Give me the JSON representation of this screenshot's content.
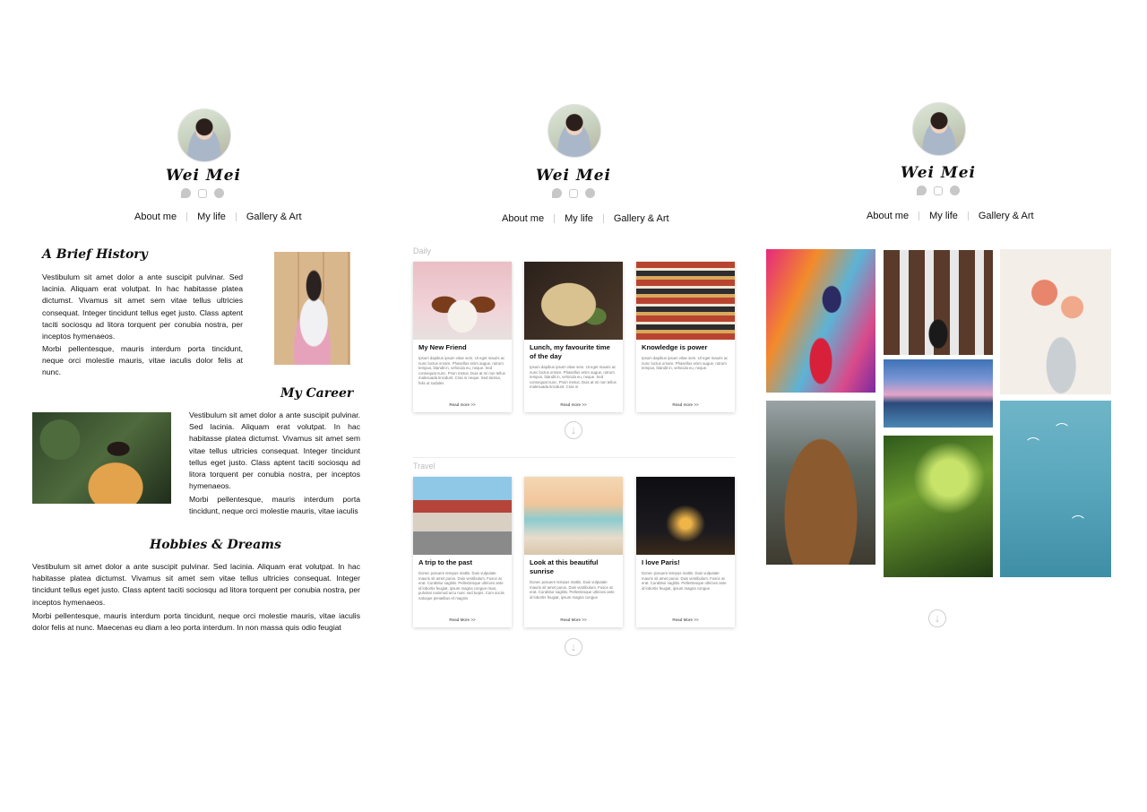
{
  "brand": "Wei Mei",
  "nav": [
    "About me",
    "My life",
    "Gallery & Art"
  ],
  "about": {
    "sections": [
      {
        "heading": "A Brief History",
        "paragraphs": [
          "Vestibulum sit amet dolor a ante suscipit pulvinar. Sed lacinia. Aliquam erat volutpat. In hac habitasse platea dictumst. Vivamus sit amet sem vitae tellus ultricies consequat. Integer tincidunt tellus eget justo. Class aptent taciti sociosqu ad litora torquent per conubia nostra, per inceptos hymenaeos.",
          "Morbi pellentesque, mauris interdum porta tincidunt, neque orci molestie mauris, vitae iaculis dolor felis at nunc."
        ]
      },
      {
        "heading": "My Career",
        "paragraphs": [
          "Vestibulum sit amet dolor a ante suscipit pulvinar. Sed lacinia. Aliquam erat volutpat. In hac habitasse platea dictumst. Vivamus sit amet sem vitae tellus ultricies consequat. Integer tincidunt tellus eget justo. Class aptent taciti sociosqu ad litora torquent per conubia nostra, per inceptos hymenaeos.",
          "Morbi pellentesque, mauris interdum porta tincidunt, neque orci molestie mauris, vitae iaculis"
        ]
      },
      {
        "heading": "Hobbies & Dreams",
        "paragraphs": [
          "Vestibulum sit amet dolor a ante suscipit pulvinar. Sed lacinia. Aliquam erat volutpat. In hac habitasse platea dictumst. Vivamus sit amet sem vitae tellus ultricies consequat. Integer tincidunt tellus eget justo. Class aptent taciti sociosqu ad litora torquent per conubia nostra, per inceptos hymenaeos.",
          "Morbi pellentesque, mauris interdum porta tincidunt, neque orci molestie mauris, vitae iaculis dolor felis at nunc. Maecenas eu diam a leo porta interdum. In non massa quis odio feugiat"
        ]
      }
    ]
  },
  "life": {
    "daily_label": "Daily",
    "travel_label": "Travel",
    "daily": [
      {
        "title": "My New Friend",
        "text": "Ipsum dapibus ipsum vitae sem. Ut eget mauris ac nunc luctus ornare. Phasellus enim augue, rutrum tempus, blandit in, vehicula eu, neque. Sed consequat nunc. Proin metus. Duis at mi non tellus malesuada tincidunt. Cras in neque. Sed lacinia, felis ut sodales",
        "more": "Read more >>"
      },
      {
        "title": "Lunch, my favourite time of the day",
        "text": "Ipsum dapibus ipsum vitae sem. Ut eget mauris ac nunc luctus ornare. Phasellus enim augue, rutrum tempus, blandit in, vehicula eu, neque. Sed consequat nunc. Proin metus. Duis at mi non tellus malesuada tincidunt. Cras in",
        "more": "Read more >>"
      },
      {
        "title": "Knowledge is power",
        "text": "Ipsum dapibus ipsum vitae sem. Ut eget mauris ac nunc luctus ornare. Phasellus enim augue, rutrum tempus, blandit in, vehicula eu, neque.",
        "more": "Read more >>"
      }
    ],
    "travel": [
      {
        "title": "A trip to the past",
        "text": "Donec posuere tempus mattis. Duis vulputate mauris sit amet purus. Duis vestibulum. Fusce at erat. Curabitur sagittis. Pellentesque ultricies ante id lobortis feugiat, ipsum magna congue risus, pulvinar euismod arcu nunc sed turpis. Cum sociis natoque penatibus et magnis",
        "more": "Read More >>"
      },
      {
        "title": "Look at this beautiful sunrise",
        "text": "Donec posuere tempus mattis. Duis vulputate mauris sit amet purus. Duis vestibulum. Fusce at erat. Curabitur sagittis. Pellentesque ultricies ante id lobortis feugiat, ipsum magna congue",
        "more": "Read More >>"
      },
      {
        "title": "I love Paris!",
        "text": "Donec posuere tempus mattis. Duis vulputate mauris sit amet purus. Duis vestibulum. Fusce at erat. Curabitur sagittis. Pellentesque ultricies ante id lobortis feugiat, ipsum magna congue",
        "more": "Read More >>"
      }
    ]
  },
  "icons": [
    "twitter-icon",
    "instagram-icon",
    "facebook-icon",
    "download-circle-icon"
  ]
}
